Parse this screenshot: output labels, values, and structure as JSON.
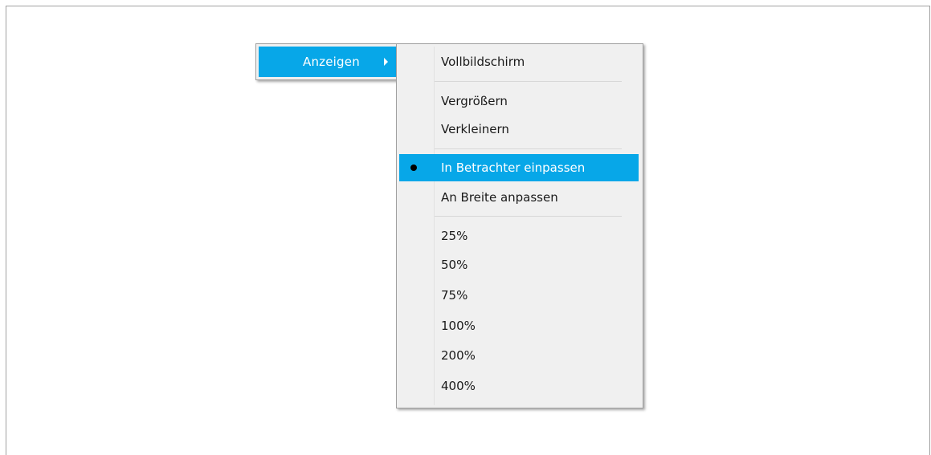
{
  "parent_menu": {
    "label": "Anzeigen"
  },
  "submenu": {
    "items": [
      {
        "label": "Vollbildschirm"
      },
      {
        "label": "Vergrößern"
      },
      {
        "label": "Verkleinern"
      },
      {
        "label": "In Betrachter einpassen",
        "selected": true,
        "checked": true
      },
      {
        "label": "An Breite anpassen"
      },
      {
        "label": "25%"
      },
      {
        "label": "50%"
      },
      {
        "label": "75%"
      },
      {
        "label": "100%"
      },
      {
        "label": "200%"
      },
      {
        "label": "400%"
      }
    ]
  },
  "colors": {
    "highlight": "#07a7e8",
    "menu_background": "#f0f0f0",
    "menu_border": "#a0a0a0"
  },
  "icons": {
    "submenu_arrow": "chevron-right-icon",
    "radio_bullet": "bullet-icon"
  }
}
